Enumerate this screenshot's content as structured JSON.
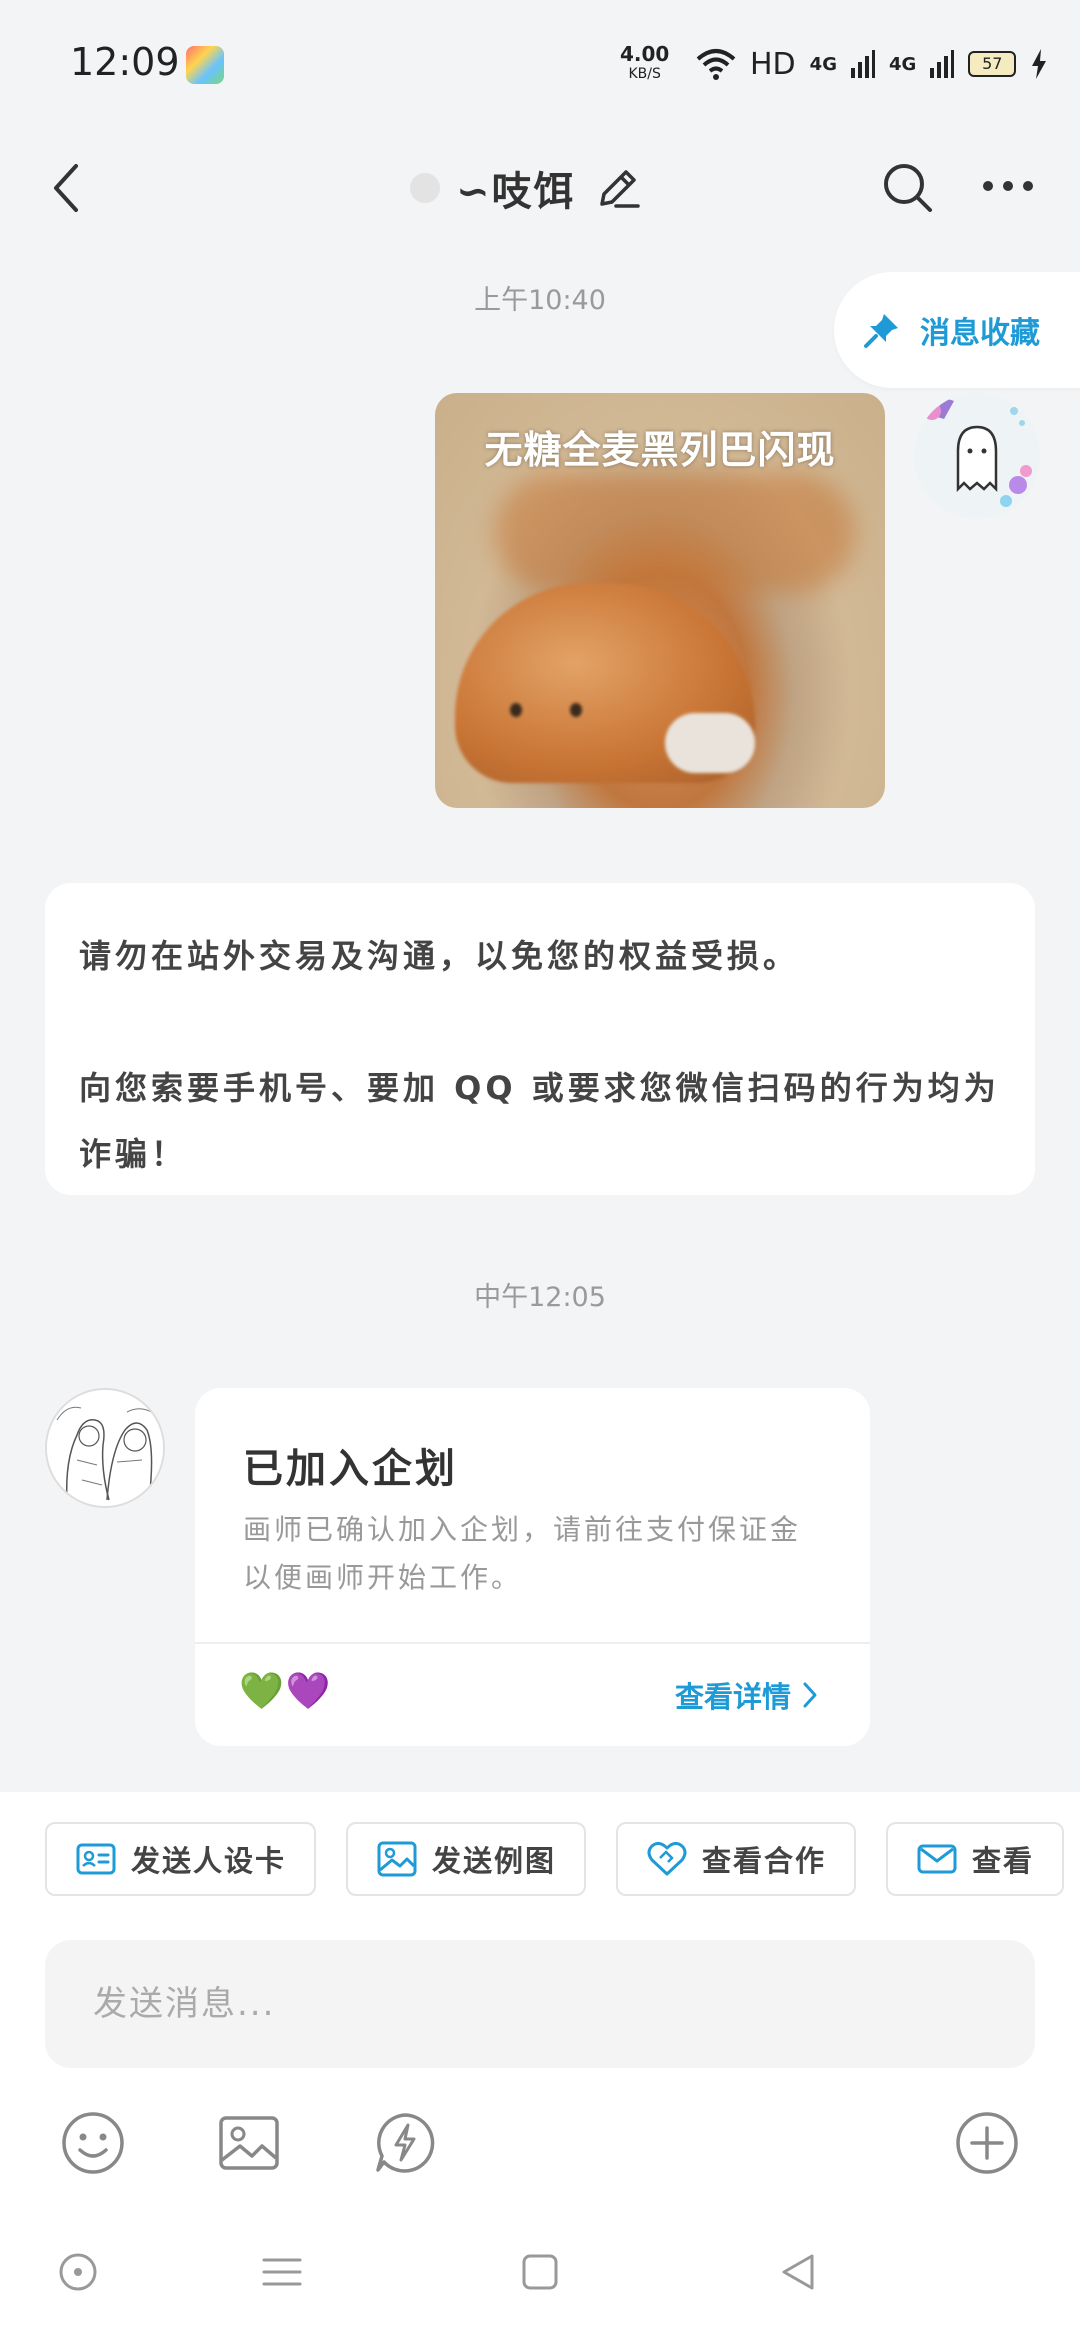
{
  "status_bar": {
    "time": "12:09",
    "net_speed": "4.00",
    "net_speed_unit": "KB/S",
    "hd": "HD",
    "signal1": "4G",
    "signal2": "4G",
    "battery": "57"
  },
  "header": {
    "title": "∽吱饵"
  },
  "messages": {
    "timestamp1": "上午10:40",
    "favorite_label": "消息收藏",
    "image_caption": "无糖全麦黑列巴闪现",
    "notice_line1": "请勿在站外交易及沟通，以免您的权益受损。",
    "notice_line2": "向您索要手机号、要加 QQ 或要求您微信扫码的行为均为诈骗！",
    "timestamp2": "中午12:05",
    "card": {
      "title": "已加入企划",
      "desc": "画师已确认加入企划，请前往支付保证金以便画师开始工作。",
      "hearts": [
        "💚",
        "💜"
      ],
      "link": "查看详情"
    }
  },
  "quick_actions": [
    {
      "label": "发送人设卡",
      "icon": "id-card-icon"
    },
    {
      "label": "发送例图",
      "icon": "image-icon"
    },
    {
      "label": "查看合作",
      "icon": "handshake-icon"
    },
    {
      "label": "查看",
      "icon": "mail-icon"
    }
  ],
  "input": {
    "placeholder": "发送消息..."
  },
  "colors": {
    "accent": "#1e9bd7",
    "background": "#f3f4f6"
  }
}
